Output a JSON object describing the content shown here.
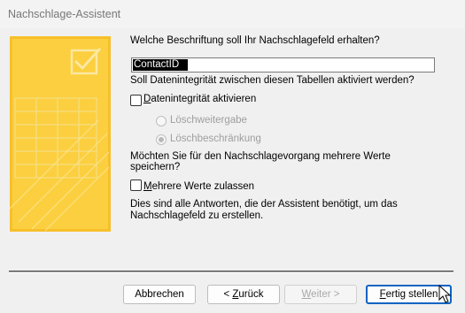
{
  "window": {
    "title": "Nachschlage-Assistent"
  },
  "prompt": {
    "question": "Welche Beschriftung soll Ihr Nachschlagefeld erhalten?"
  },
  "caption_field": {
    "value": "ContactID"
  },
  "integrity": {
    "question": "Soll Datenintegrität zwischen diesen Tabellen aktiviert werden?",
    "checkbox_label_accel": "D",
    "checkbox_label_rest": "atenintegrität aktivieren",
    "checked": false,
    "options": [
      {
        "label": "Löschweitergabe",
        "selected": false
      },
      {
        "label": "Löschbeschränkung",
        "selected": true
      }
    ]
  },
  "multivalue": {
    "question_line1": "Möchten Sie für den Nachschlagevorgang mehrere Werte",
    "question_line2": "speichern?",
    "checkbox_label_accel": "M",
    "checkbox_label_rest": "ehrere Werte zulassen",
    "checked": false
  },
  "final_note": {
    "line1": "Dies sind alle Antworten, die der Assistent benötigt, um das",
    "line2": "Nachschlagefeld zu erstellen."
  },
  "buttons": {
    "cancel": "Abbrechen",
    "back_prefix": "< ",
    "back_accel": "Z",
    "back_rest": "urück",
    "next_accel": "W",
    "next_rest": "eiter >",
    "finish_accel": "F",
    "finish_rest": "ertig stellen"
  },
  "colors": {
    "banner": "#fbcf3f",
    "default_button_border": "#0a64c2"
  }
}
